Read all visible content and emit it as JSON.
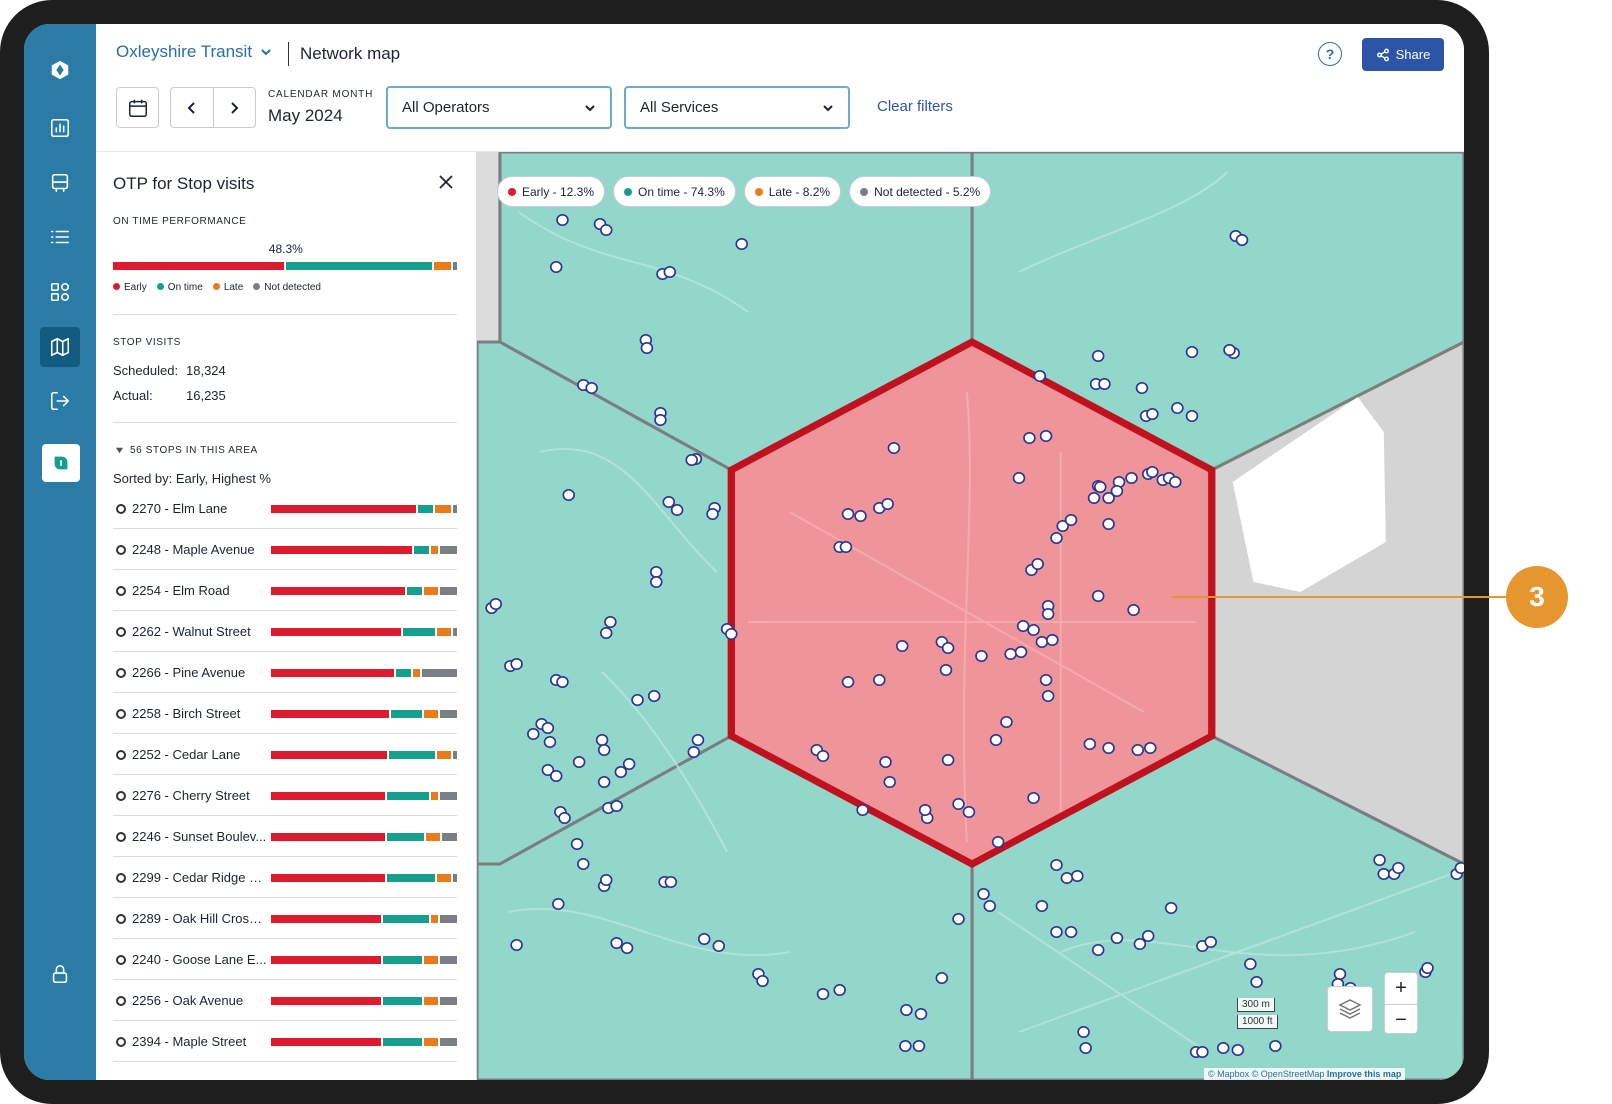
{
  "app": {
    "org_name": "Oxleyshire Transit",
    "page_title": "Network map",
    "share_label": "Share",
    "help_icon": "help-icon"
  },
  "filters": {
    "calendar_label": "CALENDAR MONTH",
    "calendar_value": "May 2024",
    "operators": "All Operators",
    "services": "All Services",
    "clear_label": "Clear filters"
  },
  "panel": {
    "title": "OTP for Stop visits",
    "otp_label": "ON TIME PERFORMANCE",
    "otp_value": "48.3%",
    "otp_breakdown": {
      "early": 48,
      "on_time": 41,
      "late": 5,
      "not_detected": 1
    },
    "legend": {
      "early": "Early",
      "on_time": "On time",
      "late": "Late",
      "not_detected": "Not detected"
    },
    "stop_visits_label": "STOP VISITS",
    "scheduled_label": "Scheduled:",
    "scheduled_value": "18,324",
    "actual_label": "Actual:",
    "actual_value": "16,235",
    "stops_header": "56 STOPS IN THIS AREA",
    "sorted_by": "Sorted by: Early, Highest %",
    "stops": [
      {
        "name": "2270 - Elm Lane",
        "early": 80,
        "on": 8,
        "late": 9,
        "nd": 2
      },
      {
        "name": "2248 - Maple Avenue",
        "early": 77,
        "on": 8,
        "late": 4,
        "nd": 9
      },
      {
        "name": "2254 - Elm Road",
        "early": 73,
        "on": 8,
        "late": 8,
        "nd": 9
      },
      {
        "name": "2262 - Walnut Street",
        "early": 71,
        "on": 17,
        "late": 8,
        "nd": 2
      },
      {
        "name": "2266 - Pine Avenue",
        "early": 67,
        "on": 8,
        "late": 4,
        "nd": 19
      },
      {
        "name": "2258 - Birch Street",
        "early": 64,
        "on": 17,
        "late": 8,
        "nd": 9
      },
      {
        "name": "2252 - Cedar Lane",
        "early": 63,
        "on": 25,
        "late": 8,
        "nd": 2
      },
      {
        "name": "2276 - Cherry Street",
        "early": 62,
        "on": 23,
        "late": 4,
        "nd": 9
      },
      {
        "name": "2246 - Sunset Boulev...",
        "early": 62,
        "on": 20,
        "late": 8,
        "nd": 8
      },
      {
        "name": "2299 - Cedar Ridge S...",
        "early": 62,
        "on": 26,
        "late": 8,
        "nd": 2
      },
      {
        "name": "2289 - Oak Hill Crossi...",
        "early": 60,
        "on": 25,
        "late": 4,
        "nd": 9
      },
      {
        "name": "2240 - Goose Lane E...",
        "early": 60,
        "on": 21,
        "late": 8,
        "nd": 9
      },
      {
        "name": "2256 - Oak Avenue",
        "early": 60,
        "on": 21,
        "late": 8,
        "nd": 9
      },
      {
        "name": "2394 - Maple Street",
        "early": 60,
        "on": 21,
        "late": 8,
        "nd": 9
      }
    ]
  },
  "map": {
    "chips": [
      {
        "label": "Early - 12.3%",
        "color": "#dc1c2e"
      },
      {
        "label": "On time - 74.3%",
        "color": "#179f8d"
      },
      {
        "label": "Late - 8.2%",
        "color": "#ea7b1a"
      },
      {
        "label": "Not detected - 5.2%",
        "color": "#7a7f86"
      }
    ],
    "zoom_in": "+",
    "zoom_out": "−",
    "scale_metric": "300 m",
    "scale_imperial": "1000 ft",
    "attribution_mapbox": "© Mapbox",
    "attribution_osm": "© OpenStreetMap",
    "attribution_improve": "Improve this map",
    "callout_number": "3"
  },
  "colors": {
    "rail": "#2a7ca6",
    "primary": "#2c55a8",
    "early": "#dc1c2e",
    "on_time": "#179f8d",
    "late": "#ea7b1a",
    "not_detected": "#7a7f86",
    "hex_selected": "#f08e93",
    "hex_border": "#c0111f",
    "callout": "#e6962e"
  }
}
